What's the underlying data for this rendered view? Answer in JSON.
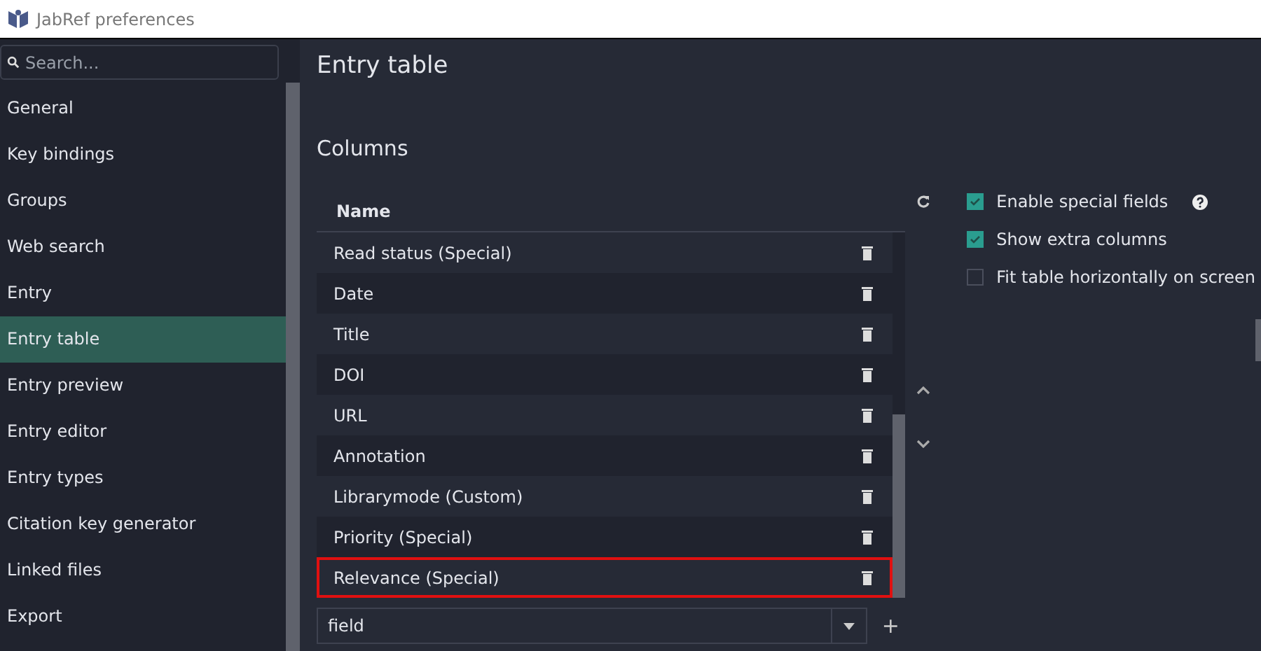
{
  "window": {
    "title": "JabRef preferences"
  },
  "sidebar": {
    "search": {
      "placeholder": "Search..."
    },
    "items": [
      {
        "label": "General",
        "selected": false
      },
      {
        "label": "Key bindings",
        "selected": false
      },
      {
        "label": "Groups",
        "selected": false
      },
      {
        "label": "Web search",
        "selected": false
      },
      {
        "label": "Entry",
        "selected": false
      },
      {
        "label": "Entry table",
        "selected": true
      },
      {
        "label": "Entry preview",
        "selected": false
      },
      {
        "label": "Entry editor",
        "selected": false
      },
      {
        "label": "Entry types",
        "selected": false
      },
      {
        "label": "Citation key generator",
        "selected": false
      },
      {
        "label": "Linked files",
        "selected": false
      },
      {
        "label": "Export",
        "selected": false
      }
    ]
  },
  "page": {
    "title": "Entry table",
    "section": "Columns"
  },
  "table": {
    "columns": [
      "Name"
    ],
    "rows": [
      {
        "name": "Read status (Special)",
        "highlighted": false
      },
      {
        "name": "Date",
        "highlighted": false
      },
      {
        "name": "Title",
        "highlighted": false
      },
      {
        "name": "DOI",
        "highlighted": false
      },
      {
        "name": "URL",
        "highlighted": false
      },
      {
        "name": "Annotation",
        "highlighted": false
      },
      {
        "name": "Librarymode (Custom)",
        "highlighted": false
      },
      {
        "name": "Priority (Special)",
        "highlighted": false
      },
      {
        "name": "Relevance (Special)",
        "highlighted": true
      }
    ]
  },
  "add_field": {
    "value": "field",
    "add_label": "+"
  },
  "options": [
    {
      "label": "Enable special fields",
      "checked": true,
      "help": true
    },
    {
      "label": "Show extra columns",
      "checked": true,
      "help": false
    },
    {
      "label": "Fit table horizontally on screen",
      "checked": false,
      "help": false
    }
  ]
}
